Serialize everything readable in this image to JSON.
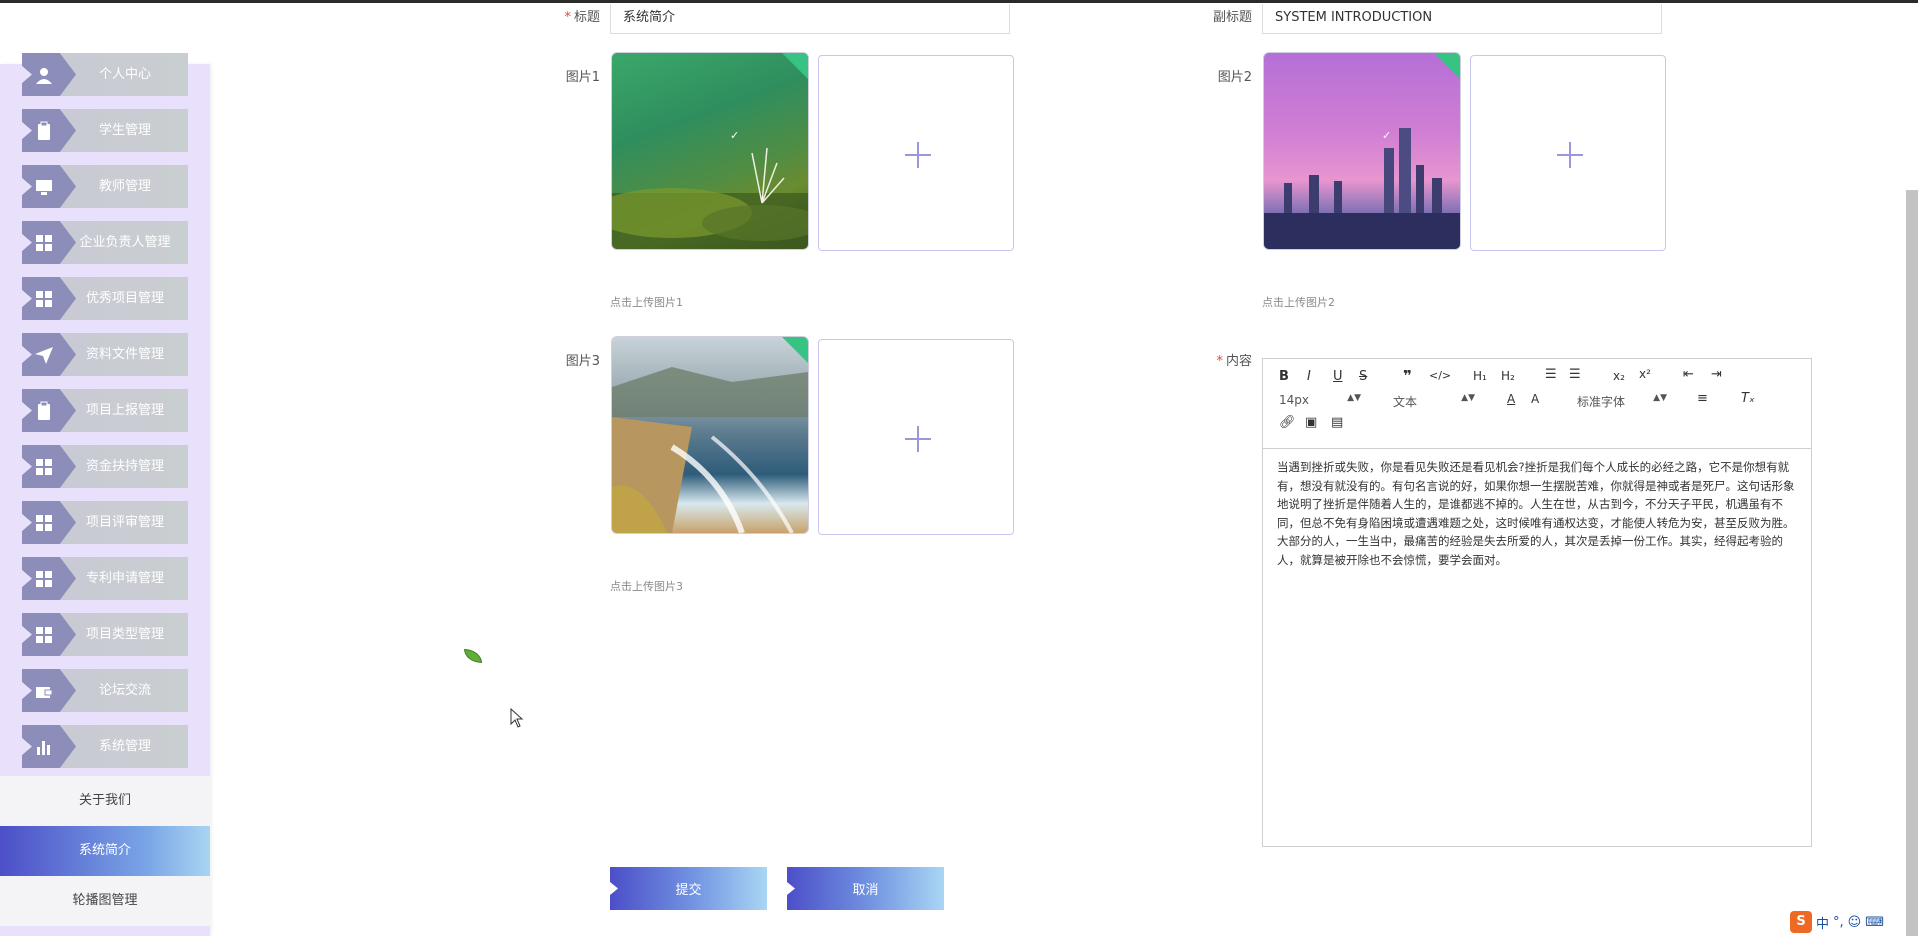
{
  "sidebar": {
    "items": [
      {
        "label": "个人中心",
        "icon": "user-icon"
      },
      {
        "label": "学生管理",
        "icon": "clipboard-icon"
      },
      {
        "label": "教师管理",
        "icon": "monitor-icon"
      },
      {
        "label": "企业负责人管理",
        "icon": "grid-icon"
      },
      {
        "label": "优秀项目管理",
        "icon": "grid-icon"
      },
      {
        "label": "资料文件管理",
        "icon": "send-icon"
      },
      {
        "label": "项目上报管理",
        "icon": "clipboard-icon"
      },
      {
        "label": "资金扶持管理",
        "icon": "grid-icon"
      },
      {
        "label": "项目评审管理",
        "icon": "grid-icon"
      },
      {
        "label": "专利申请管理",
        "icon": "grid-icon"
      },
      {
        "label": "项目类型管理",
        "icon": "grid-icon"
      },
      {
        "label": "论坛交流",
        "icon": "wallet-icon"
      },
      {
        "label": "系统管理",
        "icon": "bar-chart-icon"
      }
    ],
    "subitems": [
      {
        "label": "关于我们",
        "active": false
      },
      {
        "label": "系统简介",
        "active": true
      },
      {
        "label": "轮播图管理",
        "active": false
      }
    ]
  },
  "form": {
    "title_label": "标题",
    "title_value": "系统简介",
    "subtitle_label": "副标题",
    "subtitle_value": "SYSTEM INTRODUCTION",
    "image1_label": "图片1",
    "image1_tip": "点击上传图片1",
    "image2_label": "图片2",
    "image2_tip": "点击上传图片2",
    "image3_label": "图片3",
    "image3_tip": "点击上传图片3",
    "content_label": "内容",
    "submit_label": "提交",
    "cancel_label": "取消"
  },
  "editor": {
    "font_size": "14px",
    "paragraph": "文本",
    "font_family": "标准字体",
    "content": "当遇到挫折或失败，你是看见失败还是看见机会?挫折是我们每个人成长的必经之路，它不是你想有就有，想没有就没有的。有句名言说的好，如果你想一生摆脱苦难，你就得是神或者是死尸。这句话形象地说明了挫折是伴随着人生的，是谁都逃不掉的。人生在世，从古到今，不分天子平民，机遇虽有不同，但总不免有身陷困境或遭遇难题之处，这时候唯有通权达变，才能使人转危为安，甚至反败为胜。大部分的人，一生当中，最痛苦的经验是失去所爱的人，其次是丢掉一份工作。其实，经得起考验的人，就算是被开除也不会惊慌，要学会面对。"
  },
  "tray": {
    "ime": "中"
  },
  "colors": {
    "sidebar_bg": "#e9e1fb",
    "menu_icon_bg": "#8c8db8",
    "accent_start": "#4c4fc8",
    "accent_end": "#a9d6f4",
    "check_corner": "#37c383",
    "required": "#e54545"
  }
}
